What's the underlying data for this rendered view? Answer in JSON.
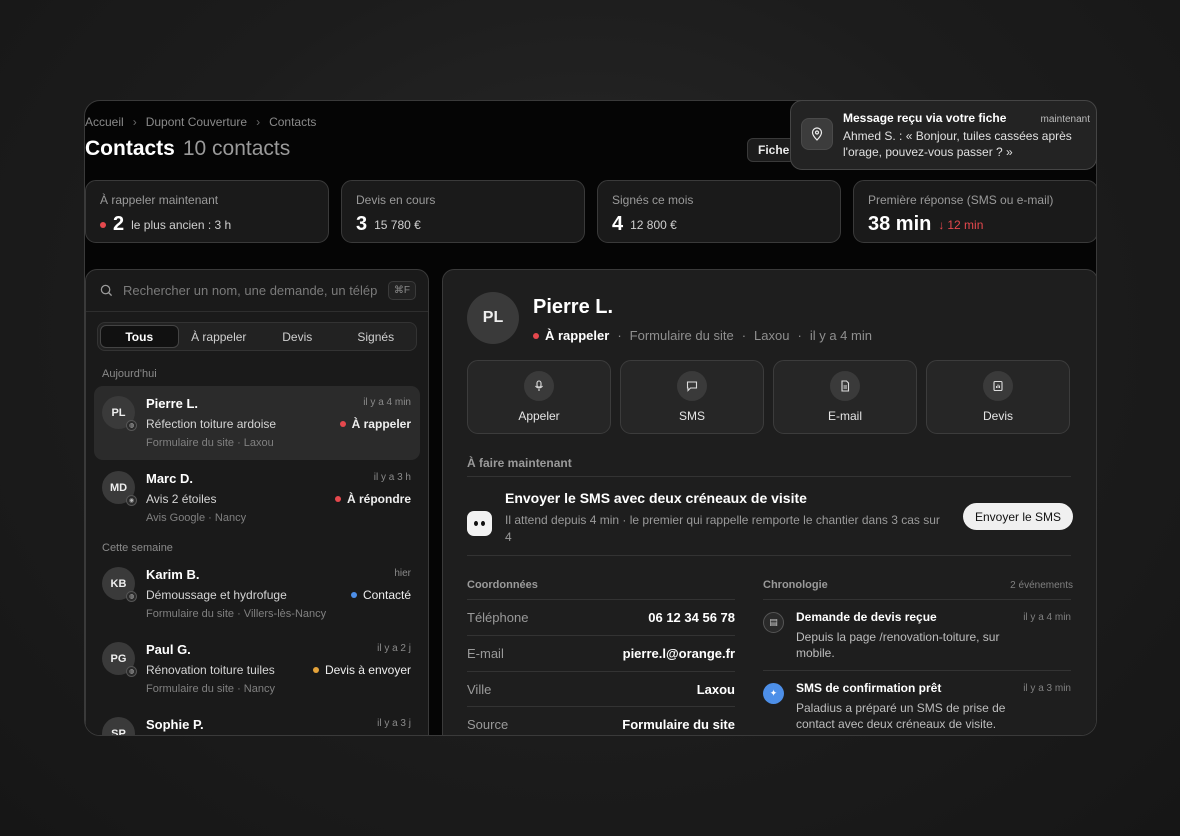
{
  "breadcrumb": [
    "Accueil",
    "Dupont Couverture",
    "Contacts"
  ],
  "header": {
    "title": "Contacts",
    "count": "10 contacts",
    "fiches_button": "Fiches"
  },
  "stats": [
    {
      "label": "À rappeler maintenant",
      "value": "2",
      "sub": "le plus ancien : 3 h"
    },
    {
      "label": "Devis en cours",
      "value": "3",
      "sub": "15 780 €"
    },
    {
      "label": "Signés ce mois",
      "value": "4",
      "sub": "12 800 €"
    },
    {
      "label": "Première réponse (SMS ou e-mail)",
      "value": "38 min",
      "sub": "12 min"
    }
  ],
  "search": {
    "placeholder": "Rechercher un nom, une demande, un téléphone",
    "shortcut": "⌘F"
  },
  "filters": [
    "Tous",
    "À rappeler",
    "Devis",
    "Signés"
  ],
  "sections": {
    "today": "Aujourd'hui",
    "week": "Cette semaine"
  },
  "contacts": [
    {
      "initials": "PL",
      "name": "Pierre L.",
      "time": "il y a 4 min",
      "request": "Réfection toiture ardoise",
      "status": "À rappeler",
      "status_color": "#e5484d",
      "source": "Formulaire du site · Laxou"
    },
    {
      "initials": "MD",
      "name": "Marc D.",
      "time": "il y a 3 h",
      "request": "Avis 2 étoiles",
      "status": "À répondre",
      "status_color": "#e5484d",
      "source": "Avis Google · Nancy"
    },
    {
      "initials": "KB",
      "name": "Karim B.",
      "time": "hier",
      "request": "Démoussage et hydrofuge",
      "status": "Contacté",
      "status_color": "#4d8fe8",
      "source": "Formulaire du site · Villers-lès-Nancy"
    },
    {
      "initials": "PG",
      "name": "Paul G.",
      "time": "il y a 2 j",
      "request": "Rénovation toiture tuiles",
      "status": "Devis à envoyer",
      "status_color": "#e5a33a",
      "source": "Formulaire du site · Nancy"
    },
    {
      "initials": "SP",
      "name": "Sophie P.",
      "time": "il y a 3 j"
    }
  ],
  "detail": {
    "initials": "PL",
    "name": "Pierre L.",
    "status": "À rappeler",
    "source": "Formulaire du site",
    "city": "Laxou",
    "time": "il y a 4 min",
    "actions": [
      "Appeler",
      "SMS",
      "E-mail",
      "Devis"
    ],
    "todo_label": "À faire maintenant",
    "todo_title": "Envoyer le SMS avec deux créneaux de visite",
    "todo_desc": "Il attend depuis 4 min · le premier qui rappelle remporte le chantier dans 3 cas sur 4",
    "todo_button": "Envoyer le SMS",
    "coord_label": "Coordonnées",
    "coordinates": [
      {
        "k": "Téléphone",
        "v": "06 12 34 56 78"
      },
      {
        "k": "E-mail",
        "v": "pierre.l@orange.fr"
      },
      {
        "k": "Ville",
        "v": "Laxou"
      },
      {
        "k": "Source",
        "v": "Formulaire du site"
      }
    ],
    "chrono_label": "Chronologie",
    "chrono_count": "2 événements",
    "chronology": [
      {
        "title": "Demande de devis reçue",
        "desc": "Depuis la page /renovation-toiture, sur mobile.",
        "time": "il y a 4 min"
      },
      {
        "title": "SMS de confirmation prêt",
        "desc": "Paladius a préparé un SMS de prise de contact avec deux créneaux de visite.",
        "time": "il y a 3 min"
      }
    ]
  },
  "toast": {
    "title": "Message reçu via votre fiche",
    "time": "maintenant",
    "body": "Ahmed S. : « Bonjour, tuiles cassées après l'orage, pouvez-vous passer ? »"
  },
  "colors": {
    "urgent": "#e5484d",
    "info": "#4d8fe8",
    "warning": "#e5a33a"
  }
}
